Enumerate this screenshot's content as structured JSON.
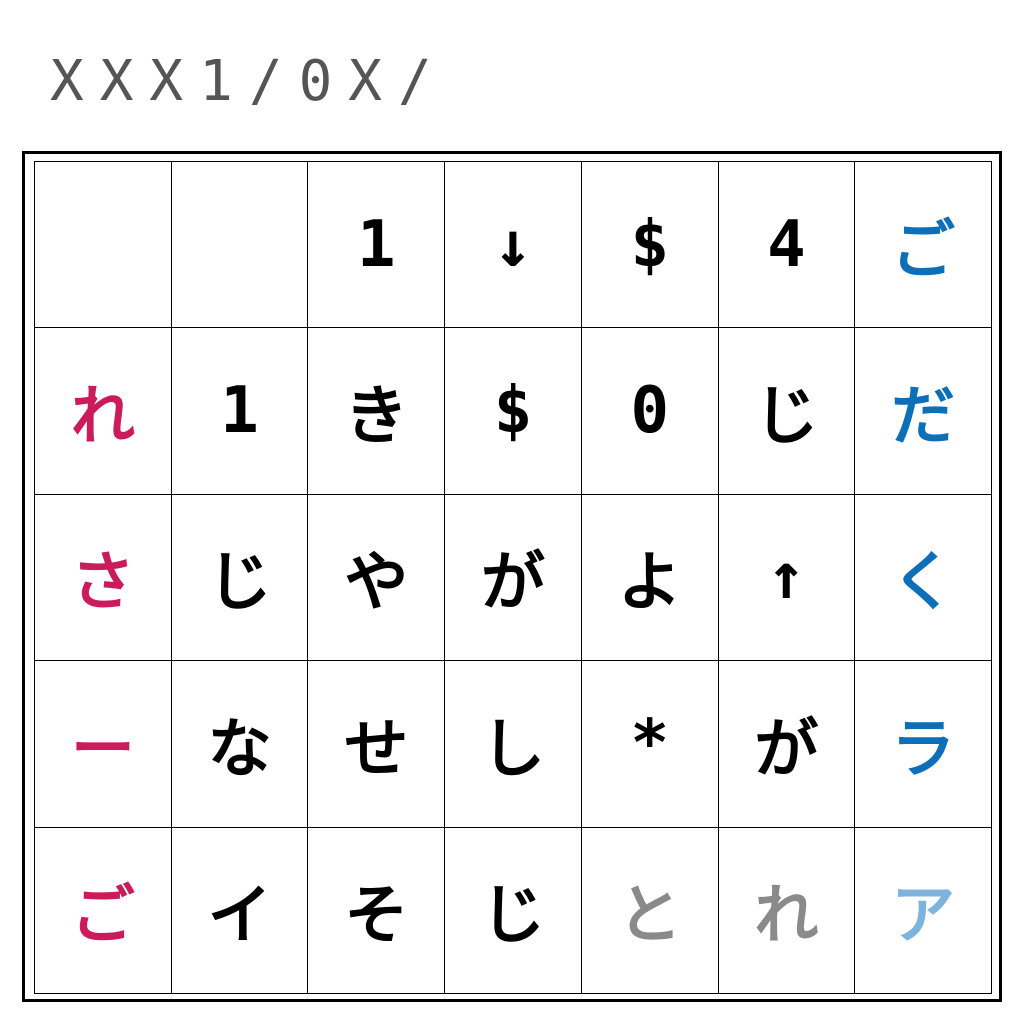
{
  "header": {
    "code": "XXX1/0X/"
  },
  "colors": {
    "black": "#000000",
    "magenta": "#cc1b5a",
    "blue": "#0d6fb8",
    "gray": "#8a8a8a",
    "light_blue": "#7db4dd"
  },
  "board": {
    "rows": [
      [
        {
          "char": "",
          "color": "black"
        },
        {
          "char": "",
          "color": "black"
        },
        {
          "char": "1",
          "color": "black"
        },
        {
          "char": "↓",
          "color": "black"
        },
        {
          "char": "$",
          "color": "black"
        },
        {
          "char": "4",
          "color": "black"
        },
        {
          "char": "ご",
          "color": "blue"
        }
      ],
      [
        {
          "char": "れ",
          "color": "magenta"
        },
        {
          "char": "1",
          "color": "black"
        },
        {
          "char": "き",
          "color": "black"
        },
        {
          "char": "$",
          "color": "black"
        },
        {
          "char": "0",
          "color": "black"
        },
        {
          "char": "じ",
          "color": "black"
        },
        {
          "char": "だ",
          "color": "blue"
        }
      ],
      [
        {
          "char": "さ",
          "color": "magenta"
        },
        {
          "char": "じ",
          "color": "black"
        },
        {
          "char": "や",
          "color": "black"
        },
        {
          "char": "が",
          "color": "black"
        },
        {
          "char": "よ",
          "color": "black"
        },
        {
          "char": "↑",
          "color": "black"
        },
        {
          "char": "く",
          "color": "blue"
        }
      ],
      [
        {
          "char": "ー",
          "color": "magenta"
        },
        {
          "char": "な",
          "color": "black"
        },
        {
          "char": "せ",
          "color": "black"
        },
        {
          "char": "し",
          "color": "black"
        },
        {
          "char": "*",
          "color": "black"
        },
        {
          "char": "が",
          "color": "black"
        },
        {
          "char": "ラ",
          "color": "blue"
        }
      ],
      [
        {
          "char": "ご",
          "color": "magenta"
        },
        {
          "char": "イ",
          "color": "black"
        },
        {
          "char": "そ",
          "color": "black"
        },
        {
          "char": "じ",
          "color": "black"
        },
        {
          "char": "と",
          "color": "gray"
        },
        {
          "char": "れ",
          "color": "gray"
        },
        {
          "char": "ア",
          "color": "light_blue"
        }
      ]
    ]
  }
}
